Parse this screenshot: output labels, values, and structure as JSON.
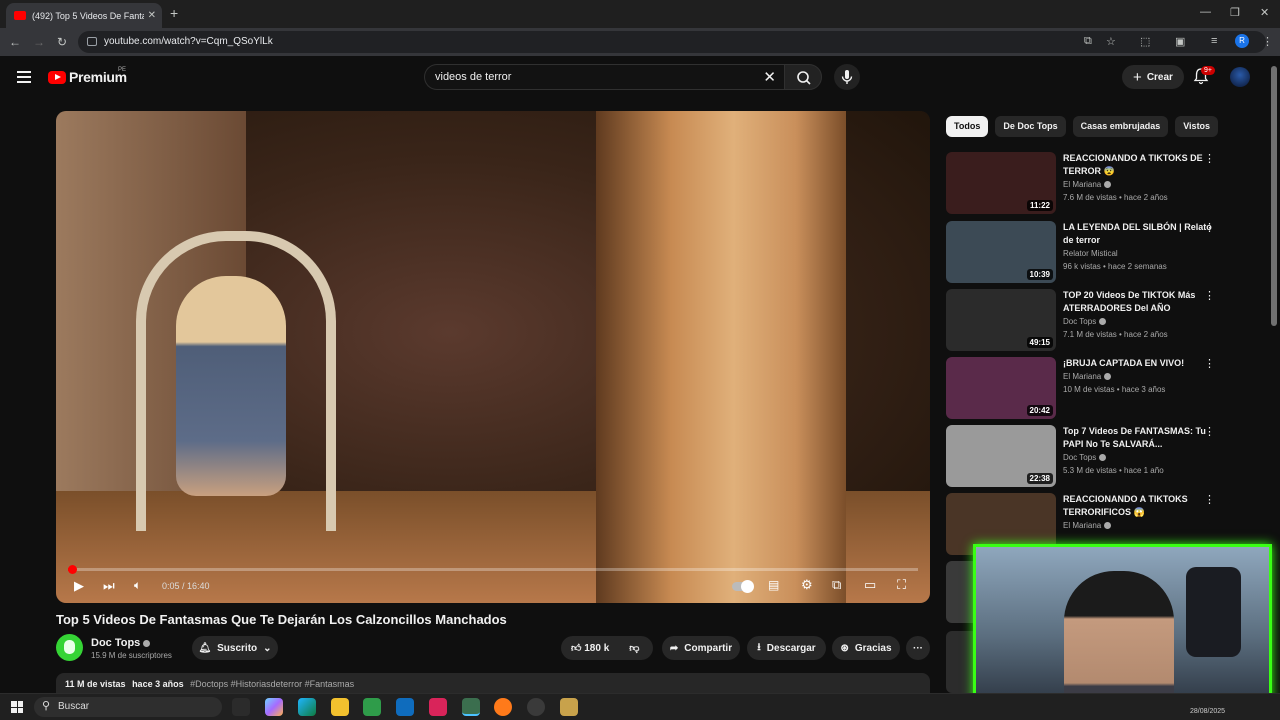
{
  "browser": {
    "tab_title": "(492) Top 5 Videos De Fantasmas",
    "tab_close": "✕",
    "new_tab": "+",
    "url": "youtube.com/watch?v=Cqm_QSoYlLk",
    "profile_initial": "R"
  },
  "header": {
    "logo_text": "Premium",
    "country_code": "PE",
    "search_value": "videos de terror",
    "create_label": "Crear",
    "notif_count": "9+"
  },
  "player": {
    "time": "0:05 / 16:40",
    "progress": 0.005
  },
  "video": {
    "title": "Top 5 Videos De Fantasmas Que Te Dejarán Los Calzoncillos Manchados",
    "channel": "Doc Tops",
    "subscribers": "15.9 M de suscriptores",
    "subscribed_label": "Suscrito",
    "likes": "180 k",
    "share_label": "Compartir",
    "download_label": "Descargar",
    "thanks_label": "Gracias",
    "views": "11 M de vistas",
    "age": "hace 3 años",
    "tags": "#Doctops #Historiasdeterror #Fantasmas"
  },
  "chips": [
    "Todos",
    "De Doc Tops",
    "Casas embrujadas",
    "Vistos"
  ],
  "recommendations": [
    {
      "title": "REACCIONANDO A TIKTOKS DE TERROR 😨",
      "channel": "El Mariana",
      "meta": "7.6 M de vistas • hace 2 años",
      "duration": "11:22",
      "color": "#3a1d1d"
    },
    {
      "title": "LA LEYENDA DEL SILBÓN | Relato de terror",
      "channel": "Relator Mistical",
      "meta": "96 k vistas • hace 2 semanas",
      "duration": "10:39",
      "color": "#3c4a55"
    },
    {
      "title": "TOP 20 Videos De TIKTOK Más ATERRADORES Del AÑO",
      "channel": "Doc Tops",
      "meta": "7.1 M de vistas • hace 2 años",
      "duration": "49:15",
      "color": "#2b2b2b"
    },
    {
      "title": "¡BRUJA CAPTADA EN VIVO!",
      "channel": "El Mariana",
      "meta": "10 M de vistas • hace 3 años",
      "duration": "20:42",
      "color": "#5a2a4a"
    },
    {
      "title": "Top 7 Videos De FANTASMAS: Tu PAPI No Te SALVARÁ...",
      "channel": "Doc Tops",
      "meta": "5.3 M de vistas • hace 1 año",
      "duration": "22:38",
      "color": "#9a9a9a"
    },
    {
      "title": "REACCIONANDO A TIKTOKS TERRORIFICOS 😱",
      "channel": "El Mariana",
      "meta": "",
      "duration": "",
      "color": "#4a3526"
    }
  ],
  "taskbar": {
    "search_label": "Buscar",
    "date": "28/08/2025"
  },
  "colors": {
    "accent_red": "#ff0000",
    "cam_border": "#39ff14"
  }
}
